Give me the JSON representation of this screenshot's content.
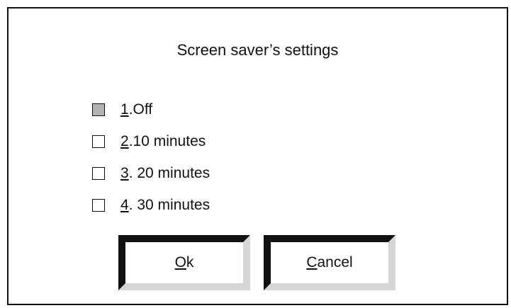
{
  "dialog": {
    "title": "Screen saver’s settings"
  },
  "options": [
    {
      "mnemonic": "1",
      "rest": ".Off",
      "checked": true
    },
    {
      "mnemonic": "2",
      "rest": ".10 minutes",
      "checked": false
    },
    {
      "mnemonic": "3",
      "rest": ". 20 minutes",
      "checked": false
    },
    {
      "mnemonic": "4",
      "rest": ". 30 minutes",
      "checked": false
    }
  ],
  "buttons": {
    "ok": {
      "mnemonic": "O",
      "rest": "k"
    },
    "cancel": {
      "mnemonic": "C",
      "rest": "ancel"
    }
  },
  "colors": {
    "checked_fill": "#b3b3b3",
    "button_shadow_dark": "#111111",
    "button_shadow_light": "#d6d6d6"
  }
}
